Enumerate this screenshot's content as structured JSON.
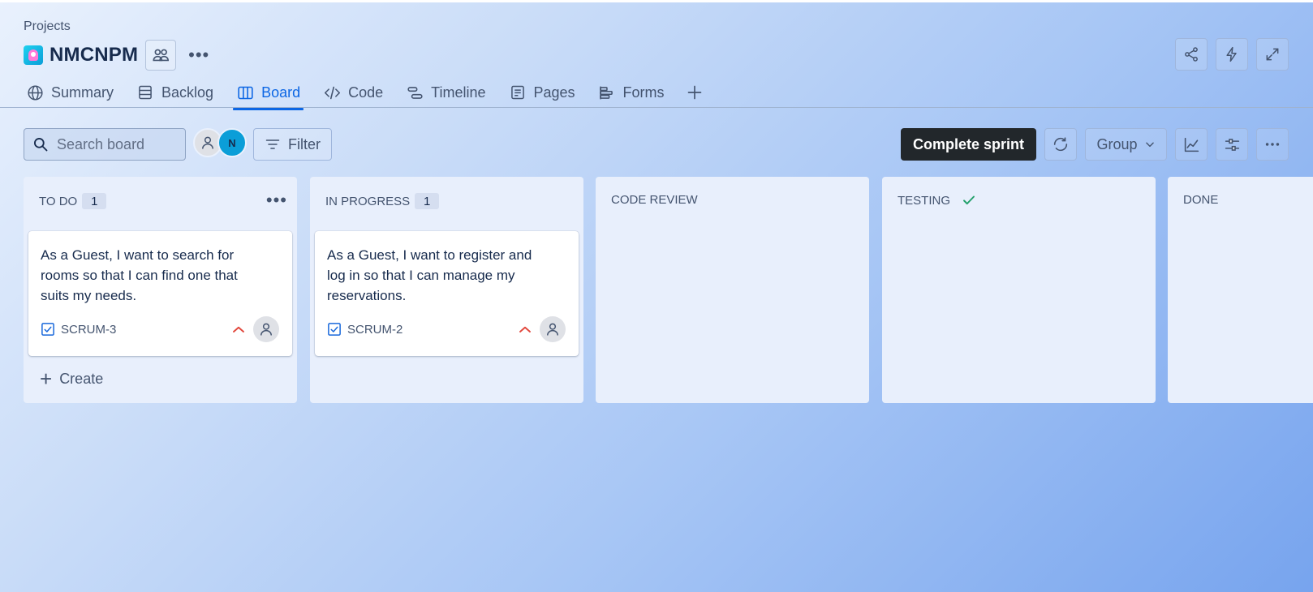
{
  "breadcrumb": "Projects",
  "project": {
    "title": "NMCNPM"
  },
  "tabs": [
    {
      "label": "Summary",
      "icon": "globe-icon"
    },
    {
      "label": "Backlog",
      "icon": "backlog-icon"
    },
    {
      "label": "Board",
      "icon": "board-icon",
      "active": true
    },
    {
      "label": "Code",
      "icon": "code-icon"
    },
    {
      "label": "Timeline",
      "icon": "timeline-icon"
    },
    {
      "label": "Pages",
      "icon": "pages-icon"
    },
    {
      "label": "Forms",
      "icon": "forms-icon"
    }
  ],
  "toolbar": {
    "search_placeholder": "Search board",
    "avatar_initial": "N",
    "filter_label": "Filter",
    "complete_label": "Complete sprint",
    "group_label": "Group"
  },
  "columns": [
    {
      "title": "TO DO",
      "count": "1",
      "card": {
        "summary": "As a Guest, I want to search for rooms so that I can find one that suits my needs.",
        "key": "SCRUM-3"
      },
      "create_label": "Create"
    },
    {
      "title": "IN PROGRESS",
      "count": "1",
      "card": {
        "summary": "As a Guest, I want to register and log in so that I can manage my reservations.",
        "key": "SCRUM-2"
      }
    },
    {
      "title": "CODE REVIEW"
    },
    {
      "title": "TESTING"
    },
    {
      "title": "DONE"
    }
  ],
  "colors": {
    "accent": "#0c66e4",
    "priority": "#e2483d",
    "done_check": "#22a06b",
    "complete_bg": "#22272b"
  }
}
